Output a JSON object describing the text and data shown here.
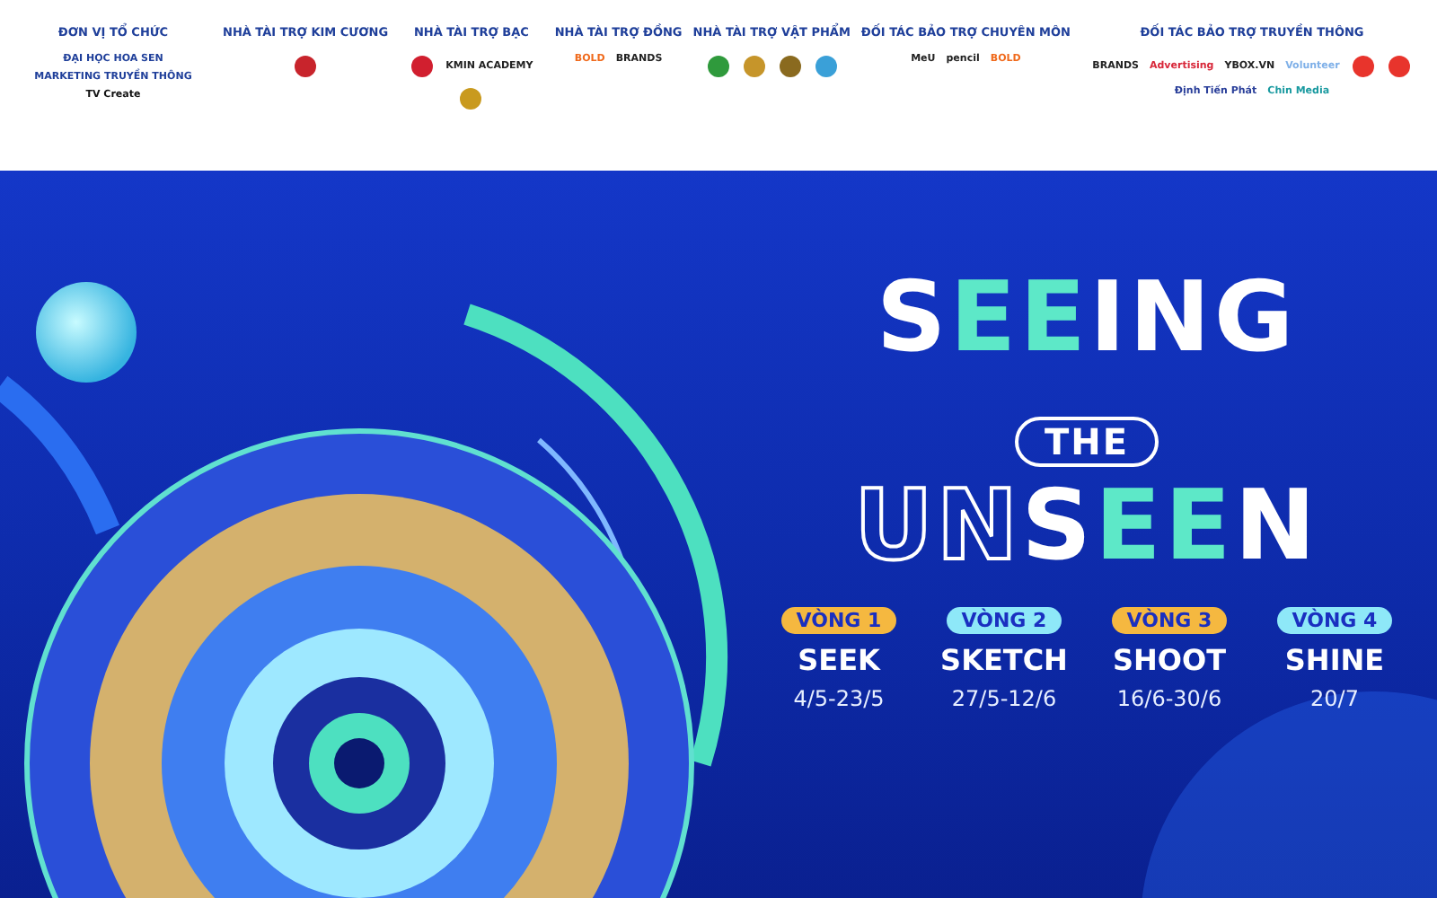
{
  "sponsors": [
    {
      "heading": "ĐƠN VỊ TỔ CHỨC",
      "logos": [
        {
          "kind": "wordmark",
          "text": "ĐẠI HỌC HOA SEN",
          "color": "#1f3f9a"
        },
        {
          "kind": "wordmark",
          "text": "MARKETING TRUYỀN THÔNG",
          "color": "#1f3f9a"
        },
        {
          "kind": "wordmark",
          "text": "TV Create",
          "color": "#111111"
        }
      ]
    },
    {
      "heading": "NHÀ TÀI TRỢ KIM CƯƠNG",
      "logos": [
        {
          "kind": "emblem",
          "color": "#c8242c"
        }
      ]
    },
    {
      "heading": "NHÀ TÀI TRỢ BẠC",
      "logos": [
        {
          "kind": "emblem",
          "color": "#d11f2f"
        },
        {
          "kind": "wordmark",
          "text": "KMIN ACADEMY",
          "color": "#222222"
        },
        {
          "kind": "emblem",
          "color": "#c99a1e"
        }
      ]
    },
    {
      "heading": "NHÀ TÀI TRỢ ĐỒNG",
      "logos": [
        {
          "kind": "wordmark",
          "text": "BOLD",
          "color": "#f06a1c"
        },
        {
          "kind": "wordmark",
          "text": "BRANDS",
          "color": "#222222"
        }
      ]
    },
    {
      "heading": "NHÀ TÀI TRỢ VẬT PHẨM",
      "logos": [
        {
          "kind": "emblem",
          "color": "#2f9a3c"
        },
        {
          "kind": "emblem",
          "color": "#c6952a"
        },
        {
          "kind": "emblem",
          "color": "#8a6a1f"
        },
        {
          "kind": "emblem",
          "color": "#3aa0d8"
        }
      ]
    },
    {
      "heading": "ĐỐI TÁC BẢO TRỢ CHUYÊN MÔN",
      "logos": [
        {
          "kind": "wordmark",
          "text": "MeU",
          "color": "#222222"
        },
        {
          "kind": "wordmark",
          "text": "pencil",
          "color": "#222222"
        },
        {
          "kind": "wordmark",
          "text": "BOLD",
          "color": "#f06a1c"
        }
      ]
    },
    {
      "heading": "ĐỐI TÁC BẢO TRỢ TRUYỀN THÔNG",
      "logos": [
        {
          "kind": "wordmark",
          "text": "BRANDS",
          "color": "#222222"
        },
        {
          "kind": "wordmark",
          "text": "Advertising",
          "color": "#d8283a"
        },
        {
          "kind": "wordmark",
          "text": "YBOX.VN",
          "color": "#222222"
        },
        {
          "kind": "wordmark",
          "text": "Volunteer",
          "color": "#7fb0e8"
        },
        {
          "kind": "emblem",
          "color": "#e8342c"
        },
        {
          "kind": "emblem",
          "color": "#e8342c"
        },
        {
          "kind": "wordmark",
          "text": "Định Tiến Phát",
          "color": "#2a3f9a"
        },
        {
          "kind": "wordmark",
          "text": "Chin Media",
          "color": "#1a9aa0"
        }
      ]
    }
  ],
  "title": {
    "lines": [
      [
        {
          "text": "S",
          "kind": "solid"
        },
        {
          "text": "EE",
          "kind": "accent"
        },
        {
          "text": "ING",
          "kind": "solid"
        }
      ],
      [
        {
          "text": "THE",
          "kind": "pill"
        }
      ],
      [
        {
          "text": "UN",
          "kind": "outline"
        },
        {
          "text": "S",
          "kind": "solid"
        },
        {
          "text": "EE",
          "kind": "accent"
        },
        {
          "text": "N",
          "kind": "solid"
        }
      ]
    ]
  },
  "rounds": [
    {
      "badge": "VÒNG 1",
      "color": "#f5b840",
      "name": "SEEK",
      "dates": "4/5-23/5"
    },
    {
      "badge": "VÒNG 2",
      "color": "#8ee8f8",
      "name": "SKETCH",
      "dates": "27/5-12/6"
    },
    {
      "badge": "VÒNG 3",
      "color": "#f5b840",
      "name": "SHOOT",
      "dates": "16/6-30/6"
    },
    {
      "badge": "VÒNG 4",
      "color": "#8ee8f8",
      "name": "SHINE",
      "dates": "20/7"
    }
  ]
}
